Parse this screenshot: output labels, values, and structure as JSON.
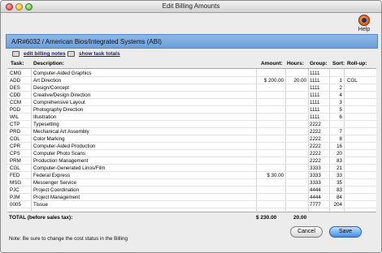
{
  "window": {
    "title": "Edit Billing Amounts"
  },
  "help": {
    "label": "Help"
  },
  "header": {
    "text": "A/R#6032 / American Bios/Integrated Systems (ABI)"
  },
  "links": {
    "edit_billing_notes": "edit billing notes",
    "show_task_totals": "show task totals"
  },
  "columns": {
    "task": "Task:",
    "description": "Description:",
    "amount": "Amount:",
    "hours": "Hours:",
    "group": "Group:",
    "sort": "Sort:",
    "rollup": "Roll-up:"
  },
  "rows": [
    {
      "task": "CMG",
      "description": "Computer-Aided Graphics",
      "amount": "",
      "hours": "",
      "group": "1111",
      "sort": "",
      "rollup": ""
    },
    {
      "task": "ADD",
      "description": "Art Direction",
      "amount": "$ 200.00",
      "hours": "20.00",
      "group": "1111",
      "sort": "1",
      "rollup": "CGL"
    },
    {
      "task": "DES",
      "description": "Design/Concept",
      "amount": "",
      "hours": "",
      "group": "1111",
      "sort": "2",
      "rollup": ""
    },
    {
      "task": "CDD",
      "description": "Creative/Design Direction",
      "amount": "",
      "hours": "",
      "group": "1111",
      "sort": "4",
      "rollup": ""
    },
    {
      "task": "CCM",
      "description": "Comprehensive Layout",
      "amount": "",
      "hours": "",
      "group": "1111",
      "sort": "3",
      "rollup": ""
    },
    {
      "task": "PDD",
      "description": "Photography Direction",
      "amount": "",
      "hours": "",
      "group": "1111",
      "sort": "5",
      "rollup": ""
    },
    {
      "task": "WIL",
      "description": "Illustration",
      "amount": "",
      "hours": "",
      "group": "1111",
      "sort": "6",
      "rollup": ""
    },
    {
      "task": "CTP",
      "description": "Typesetting",
      "amount": "",
      "hours": "",
      "group": "2222",
      "sort": "",
      "rollup": ""
    },
    {
      "task": "PRD",
      "description": "Mechanical Art Assembly",
      "amount": "",
      "hours": "",
      "group": "2222",
      "sort": "7",
      "rollup": ""
    },
    {
      "task": "COL",
      "description": "Color Marking",
      "amount": "",
      "hours": "",
      "group": "2222",
      "sort": "8",
      "rollup": ""
    },
    {
      "task": "CPR",
      "description": "Computer-Aided Production",
      "amount": "",
      "hours": "",
      "group": "2222",
      "sort": "16",
      "rollup": ""
    },
    {
      "task": "CPS",
      "description": "Computer Photo Scans",
      "amount": "",
      "hours": "",
      "group": "2222",
      "sort": "20",
      "rollup": ""
    },
    {
      "task": "PRM",
      "description": "Production Management",
      "amount": "",
      "hours": "",
      "group": "2222",
      "sort": "83",
      "rollup": ""
    },
    {
      "task": "CGL",
      "description": "Computer-Generated Linos/Film",
      "amount": "",
      "hours": "",
      "group": "3333",
      "sort": "21",
      "rollup": ""
    },
    {
      "task": "FED",
      "description": "Federal Express",
      "amount": "$ 30.00",
      "hours": "",
      "group": "3333",
      "sort": "33",
      "rollup": ""
    },
    {
      "task": "MSG",
      "description": "Messenger Service",
      "amount": "",
      "hours": "",
      "group": "3333",
      "sort": "35",
      "rollup": ""
    },
    {
      "task": "PJC",
      "description": "Project Coordination",
      "amount": "",
      "hours": "",
      "group": "4444",
      "sort": "83",
      "rollup": ""
    },
    {
      "task": "PJM",
      "description": "Project Management",
      "amount": "",
      "hours": "",
      "group": "4444",
      "sort": "84",
      "rollup": ""
    },
    {
      "task": "0005",
      "description": "Tissue",
      "amount": "",
      "hours": "",
      "group": "7777",
      "sort": "204",
      "rollup": ""
    }
  ],
  "total": {
    "label": "TOTAL (before sales tax):",
    "amount": "$ 230.00",
    "hours": "20.00"
  },
  "note": "Note:  Be sure to change the cost status in the Billing",
  "buttons": {
    "cancel": "Cancel",
    "save": "Save"
  },
  "colors": {
    "header_band": "#7aaae0",
    "save_button": "#3f8fe6"
  }
}
